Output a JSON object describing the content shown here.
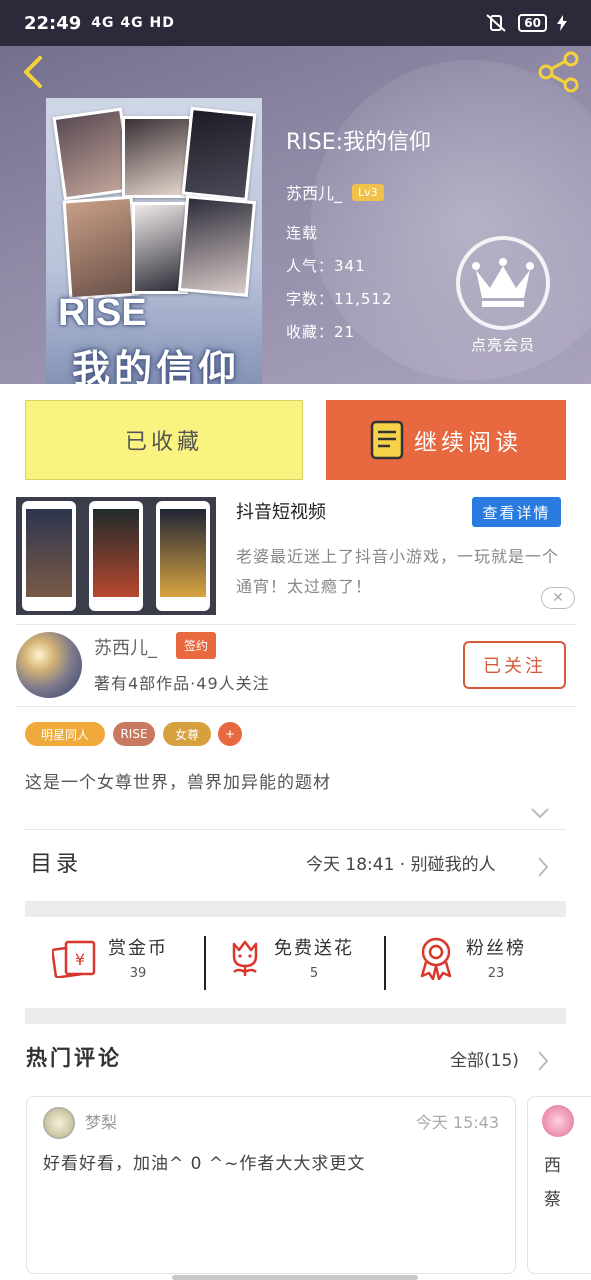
{
  "status_bar": {
    "time": "22:49",
    "network": "4G 4G HD",
    "battery": "60"
  },
  "book": {
    "title": "RISE:我的信仰",
    "author": "苏西儿_",
    "level": "Lv3",
    "status": "连载",
    "popularity": "人气：341",
    "word_count": "字数：11,512",
    "favorites": "收藏：21",
    "cover_title_en": "RISE",
    "cover_title_cn": "我的信仰"
  },
  "vip": {
    "label": "点亮会员"
  },
  "actions": {
    "favorited_label": "已收藏",
    "continue_label": "继续阅读"
  },
  "ad": {
    "title": "抖音短视频",
    "detail_button": "查看详情",
    "description": "老婆最近迷上了抖音小游戏，一玩就是一个通宵！太过瘾了！",
    "close_glyph": "✕"
  },
  "author_card": {
    "name": "苏西儿_",
    "badge": "签约",
    "stats": "著有4部作品·49人关注",
    "follow_label": "已关注"
  },
  "tags": [
    {
      "label": "明星同人",
      "color": "#f0a93b"
    },
    {
      "label": "RISE",
      "color": "#c9795f"
    },
    {
      "label": "女尊",
      "color": "#d6a03e"
    },
    {
      "label": "+",
      "color": "#e8693f"
    }
  ],
  "description": "这是一个女尊世界，兽界加异能的题材",
  "toc": {
    "label": "目录",
    "latest": "今天 18:41 · 别碰我的人"
  },
  "rewards": [
    {
      "label": "赏金币",
      "count": "39",
      "icon": "red-envelope-icon"
    },
    {
      "label": "免费送花",
      "count": "5",
      "icon": "flower-icon"
    },
    {
      "label": "粉丝榜",
      "count": "23",
      "icon": "award-ribbon-icon"
    }
  ],
  "comments": {
    "title": "热门评论",
    "all_label": "全部(15)",
    "items": [
      {
        "user": "梦梨",
        "time": "今天 15:43",
        "text": "好看好看，加油^ 0 ^~作者大大求更文"
      },
      {
        "text": "西蔡"
      }
    ]
  },
  "colors": {
    "accent_orange": "#e8693f",
    "fav_yellow": "#fbf37f",
    "ad_blue": "#2a7be0"
  }
}
